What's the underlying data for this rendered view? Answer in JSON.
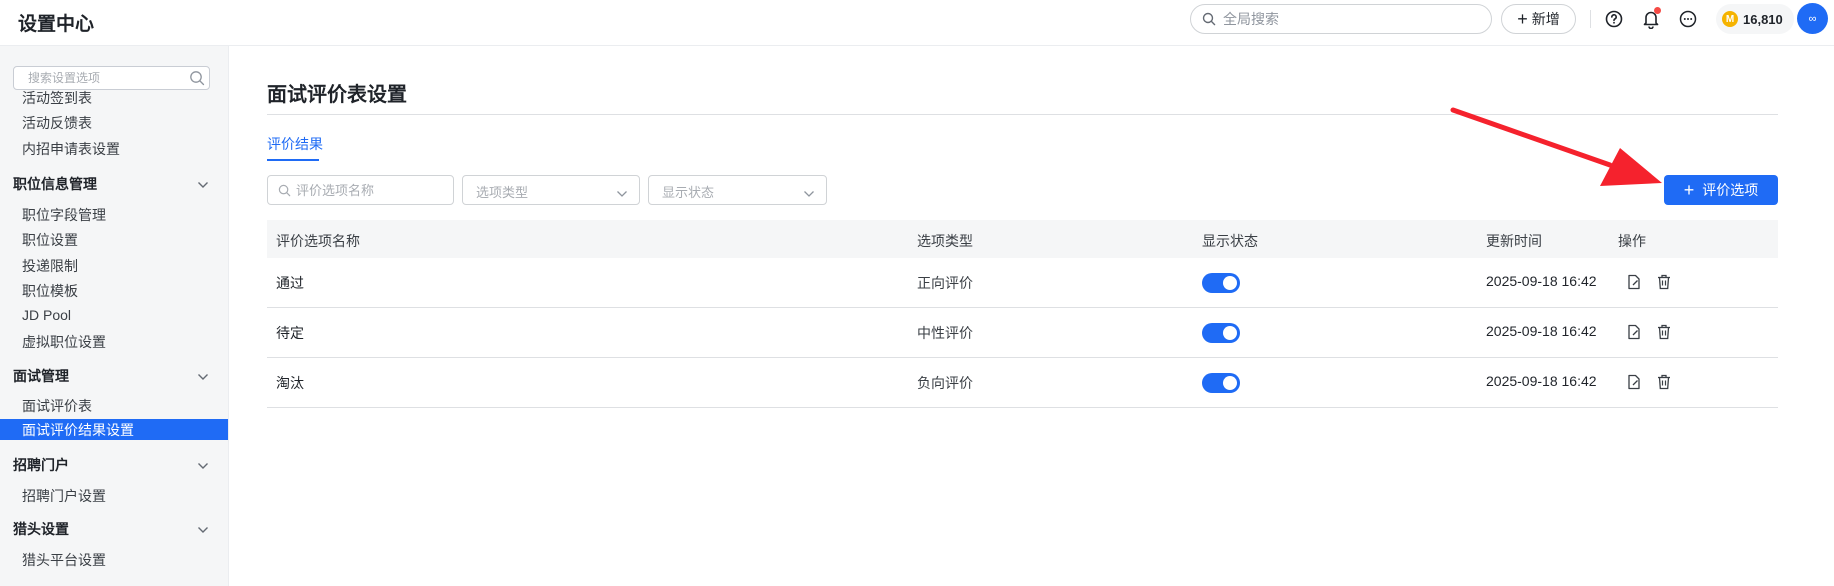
{
  "header": {
    "title": "设置中心",
    "search_placeholder": "全局搜索",
    "new_label": "新增",
    "coins": "16,810",
    "avatar_text": "∞"
  },
  "sidebar": {
    "search_placeholder": "搜索设置选项",
    "items_top": [
      "活动签到表",
      "活动反馈表",
      "内招申请表设置"
    ],
    "group_position": "职位信息管理",
    "items_position": [
      "职位字段管理",
      "职位设置",
      "投递限制",
      "职位模板",
      "JD Pool",
      "虚拟职位设置"
    ],
    "group_interview": "面试管理",
    "items_interview": [
      "面试评价表",
      "面试评价结果设置"
    ],
    "group_portal": "招聘门户",
    "items_portal": [
      "招聘门户设置"
    ],
    "group_headhunter": "猎头设置",
    "items_headhunter": [
      "猎头平台设置"
    ]
  },
  "main": {
    "title": "面试评价表设置",
    "tab": "评价结果",
    "filter_name_placeholder": "评价选项名称",
    "filter_type_placeholder": "选项类型",
    "filter_status_placeholder": "显示状态",
    "add_button": "评价选项"
  },
  "table": {
    "columns": [
      "评价选项名称",
      "选项类型",
      "显示状态",
      "更新时间",
      "操作"
    ],
    "rows": [
      {
        "name": "通过",
        "type": "正向评价",
        "visible": true,
        "updated": "2025-09-18 16:42"
      },
      {
        "name": "待定",
        "type": "中性评价",
        "visible": true,
        "updated": "2025-09-18 16:42"
      },
      {
        "name": "淘汰",
        "type": "负向评价",
        "visible": true,
        "updated": "2025-09-18 16:42"
      }
    ]
  },
  "colors": {
    "accent": "#1f6bf5",
    "annotation_arrow": "#f5222d",
    "notification_dot": "#f54a45"
  }
}
